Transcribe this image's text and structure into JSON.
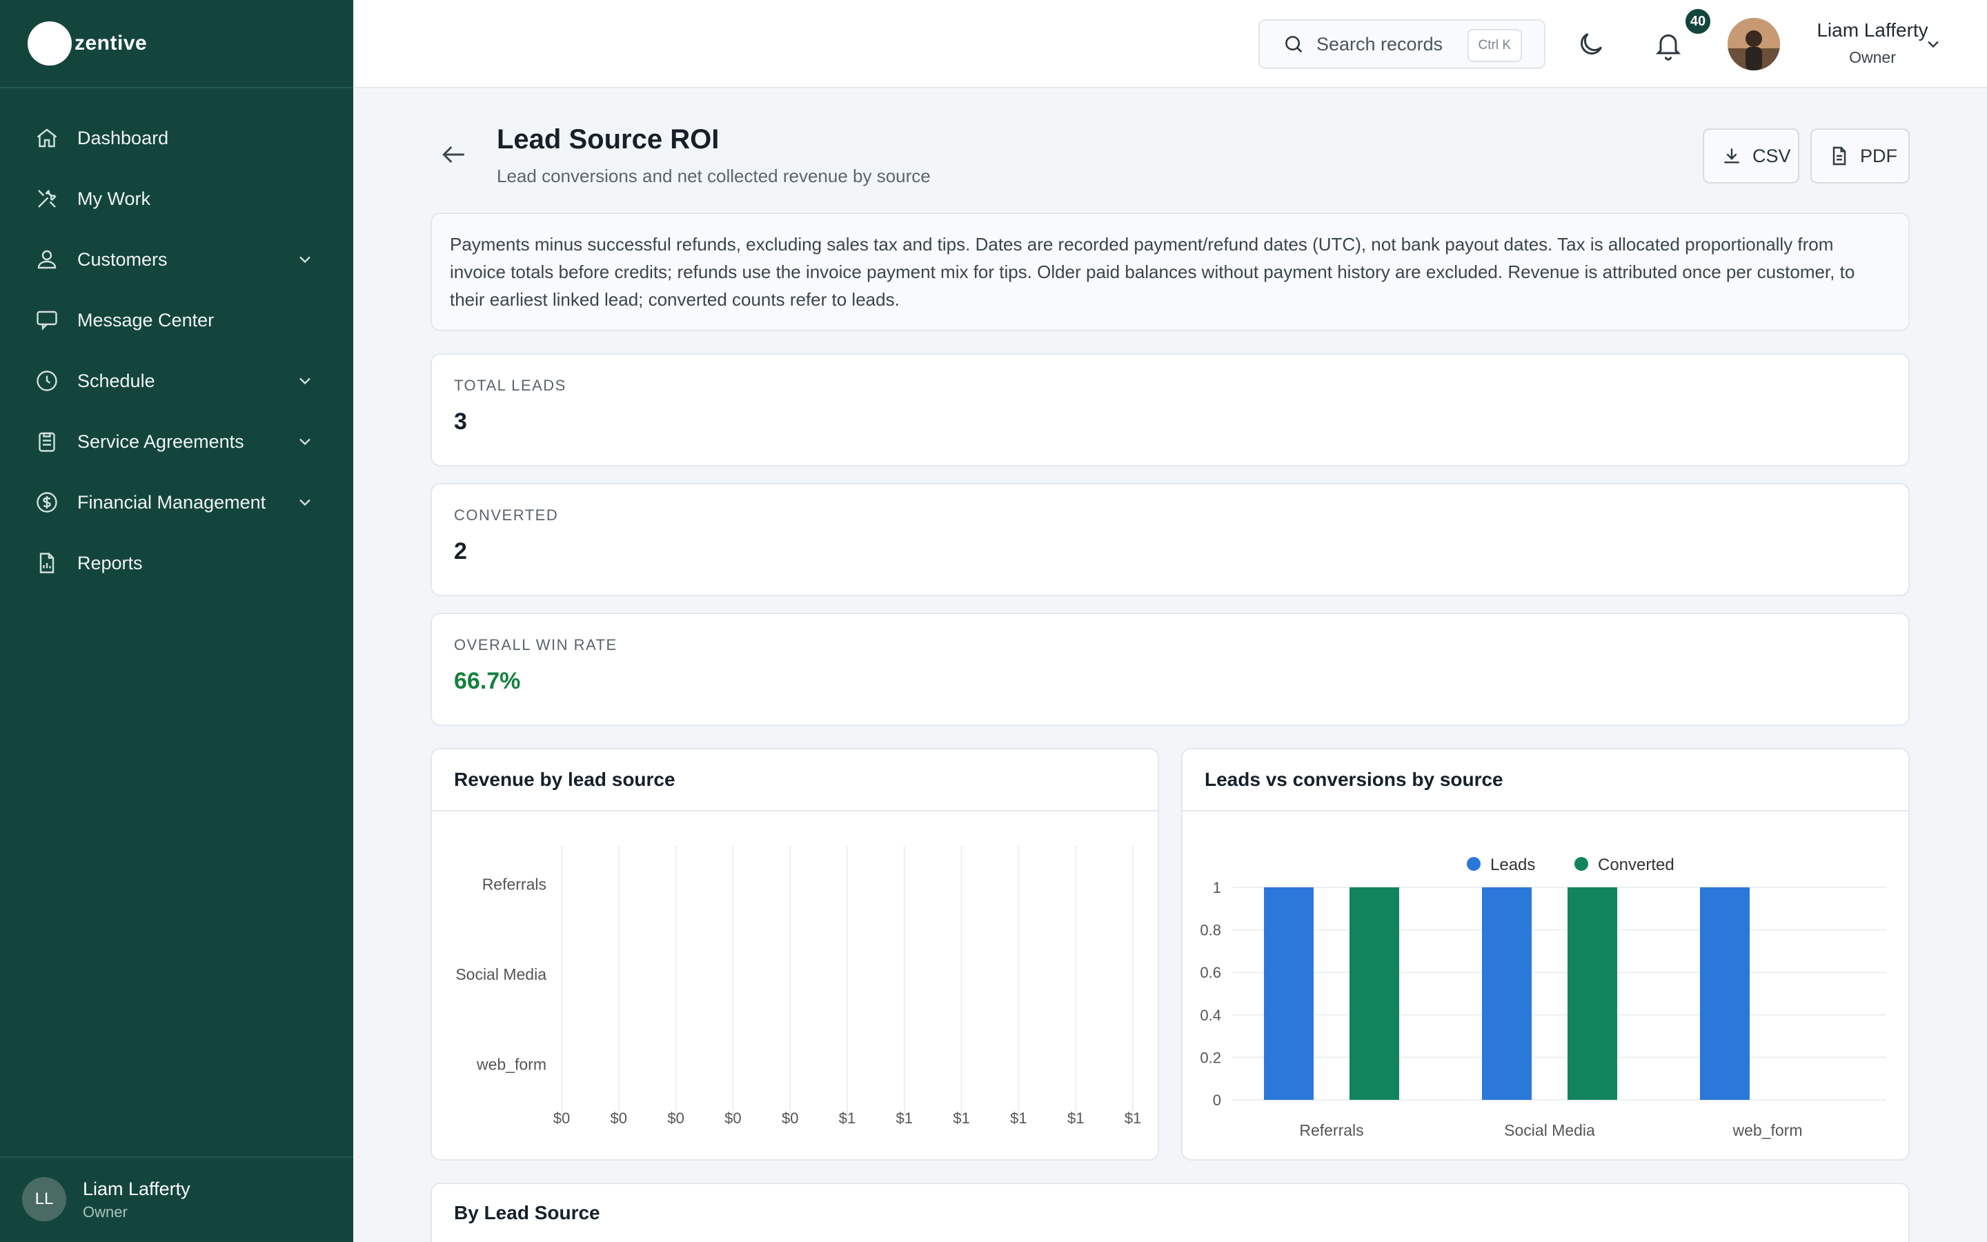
{
  "app": {
    "name": "zentive"
  },
  "sidebar": {
    "items": [
      {
        "label": "Dashboard",
        "icon": "home-icon",
        "expandable": false
      },
      {
        "label": "My Work",
        "icon": "tools-icon",
        "expandable": false
      },
      {
        "label": "Customers",
        "icon": "users-icon",
        "expandable": true
      },
      {
        "label": "Message Center",
        "icon": "chat-icon",
        "expandable": false
      },
      {
        "label": "Schedule",
        "icon": "clock-icon",
        "expandable": true
      },
      {
        "label": "Service Agreements",
        "icon": "clipboard-icon",
        "expandable": true
      },
      {
        "label": "Financial Management",
        "icon": "dollar-icon",
        "expandable": true
      },
      {
        "label": "Reports",
        "icon": "report-icon",
        "expandable": false
      }
    ],
    "user": {
      "initials": "LL",
      "name": "Liam Lafferty",
      "role": "Owner"
    }
  },
  "topbar": {
    "search_placeholder": "Search records",
    "search_shortcut": "Ctrl K",
    "notification_count": "40",
    "user_name": "Liam Lafferty",
    "user_role": "Owner"
  },
  "page": {
    "title": "Lead Source ROI",
    "subtitle": "Lead conversions and net collected revenue by source",
    "csv_label": "CSV",
    "pdf_label": "PDF",
    "note": "Payments minus successful refunds, excluding sales tax and tips. Dates are recorded payment/refund dates (UTC), not bank payout dates. Tax is allocated proportionally from invoice totals before credits; refunds use the invoice payment mix for tips. Older paid balances without payment history are excluded. Revenue is attributed once per customer, to their earliest linked lead; converted counts refer to leads."
  },
  "kpis": [
    {
      "label": "TOTAL LEADS",
      "value": "3",
      "accent": "#15202a"
    },
    {
      "label": "CONVERTED",
      "value": "2",
      "accent": "#15202a"
    },
    {
      "label": "OVERALL WIN RATE",
      "value": "66.7%",
      "accent": "#15803d"
    }
  ],
  "panels": {
    "revenue_title": "Revenue by lead source",
    "leads_title": "Leads vs conversions by source",
    "table_title": "By Lead Source"
  },
  "chart_data": [
    {
      "type": "bar",
      "orientation": "horizontal",
      "title": "Revenue by lead source",
      "categories": [
        "Referrals",
        "Social Media",
        "web_form"
      ],
      "values": [
        0,
        0,
        0
      ],
      "x_tick_labels": [
        "$0",
        "$0",
        "$0",
        "$0",
        "$0",
        "$1",
        "$1",
        "$1",
        "$1",
        "$1",
        "$1"
      ],
      "xlim": [
        0,
        1
      ],
      "grid": "vertical"
    },
    {
      "type": "bar",
      "title": "Leads vs conversions by source",
      "categories": [
        "Referrals",
        "Social Media",
        "web_form"
      ],
      "series": [
        {
          "name": "Leads",
          "values": [
            1,
            1,
            1
          ],
          "color": "#2b78db"
        },
        {
          "name": "Converted",
          "values": [
            1,
            1,
            0
          ],
          "color": "#12845d"
        }
      ],
      "y_ticks": [
        "0",
        "0.2",
        "0.4",
        "0.6",
        "0.8",
        "1"
      ],
      "ylim": [
        0,
        1
      ],
      "legend": "top-center",
      "grid": "horizontal"
    }
  ],
  "colors": {
    "sidebar": "#14453d",
    "accent_green": "#15803d"
  }
}
